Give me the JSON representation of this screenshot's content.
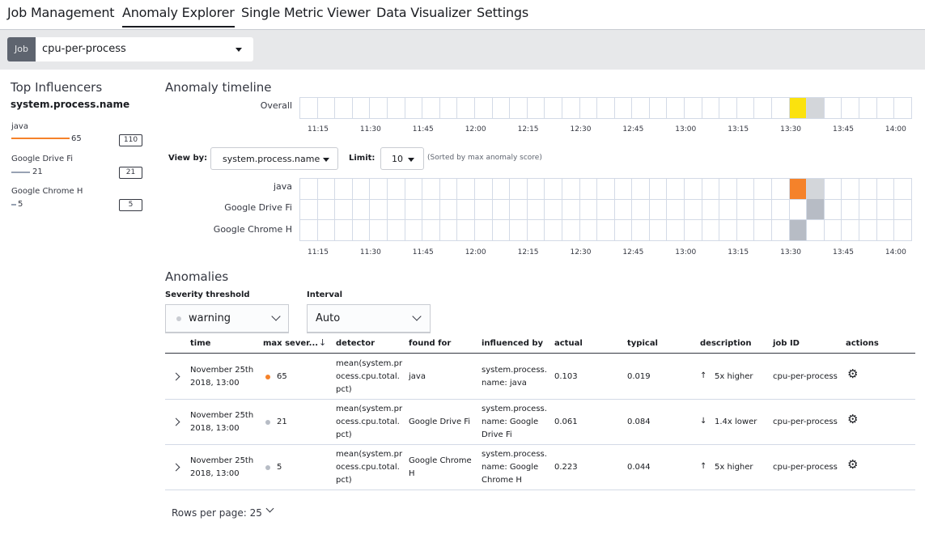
{
  "nav": {
    "tabs": [
      {
        "label": "Job Management",
        "active": false
      },
      {
        "label": "Anomaly Explorer",
        "active": true
      },
      {
        "label": "Single Metric Viewer",
        "active": false
      },
      {
        "label": "Data Visualizer",
        "active": false
      },
      {
        "label": "Settings",
        "active": false
      }
    ]
  },
  "job": {
    "tag": "Job",
    "selected": "cpu-per-process"
  },
  "influencers": {
    "title": "Top Influencers",
    "field": "system.process.name",
    "items": [
      {
        "label": "java",
        "score": "65",
        "count": "110",
        "score_fraction": 0.65,
        "color": "#f5822a"
      },
      {
        "label": "Google Drive Fi",
        "score": "21",
        "count": "21",
        "score_fraction": 0.21,
        "color": "#98a2b3"
      },
      {
        "label": "Google Chrome H",
        "score": "5",
        "count": "5",
        "score_fraction": 0.05,
        "color": "#98a2b3"
      }
    ]
  },
  "timeline": {
    "title": "Anomaly timeline",
    "overall_label": "Overall",
    "axis_ticks": [
      "11:15",
      "11:30",
      "11:45",
      "12:00",
      "12:15",
      "12:30",
      "12:45",
      "13:00",
      "13:15",
      "13:30",
      "13:45",
      "14:00"
    ],
    "view_by_label": "View by:",
    "view_by_value": "system.process.name",
    "limit_label": "Limit:",
    "limit_value": "10",
    "sort_note": "(Sorted by max anomaly score)",
    "overall_cells": [
      {
        "index": 28,
        "color": "#fbe20e"
      },
      {
        "index": 29,
        "color": "#d3d6da"
      }
    ],
    "swimlanes": [
      {
        "label": "java",
        "cells": [
          {
            "index": 28,
            "color": "#f5822a"
          },
          {
            "index": 29,
            "color": "#d3d6da"
          }
        ]
      },
      {
        "label": "Google Drive Fi",
        "cells": [
          {
            "index": 29,
            "color": "#b7bcc5"
          }
        ]
      },
      {
        "label": "Google Chrome H",
        "cells": [
          {
            "index": 28,
            "color": "#b7bcc5"
          }
        ]
      }
    ]
  },
  "anomalies": {
    "title": "Anomalies",
    "severity_label": "Severity threshold",
    "severity_value": "warning",
    "interval_label": "Interval",
    "interval_value": "Auto",
    "columns": {
      "time": "time",
      "max_severity": "max sever...",
      "detector": "detector",
      "found_for": "found for",
      "influenced_by": "influenced by",
      "actual": "actual",
      "typical": "typical",
      "description": "description",
      "job_id": "job ID",
      "actions": "actions"
    },
    "rows": [
      {
        "time_1": "November 25th",
        "time_2": "2018, 13:00",
        "severity": "65",
        "severity_color": "#f5822a",
        "detector_1": "mean(system.pr",
        "detector_2": "ocess.cpu.total.",
        "detector_3": "pct)",
        "found_for_1": "java",
        "found_for_2": "",
        "influenced_1": "system.process.",
        "influenced_2": "name: java",
        "influenced_3": "",
        "actual": "0.103",
        "typical": "0.019",
        "desc_icon": "↑",
        "description": "5x higher",
        "job_id": "cpu-per-process"
      },
      {
        "time_1": "November 25th",
        "time_2": "2018, 13:00",
        "severity": "21",
        "severity_color": "#b7bcc5",
        "detector_1": "mean(system.pr",
        "detector_2": "ocess.cpu.total.",
        "detector_3": "pct)",
        "found_for_1": "Google Drive Fi",
        "found_for_2": "",
        "influenced_1": "system.process.",
        "influenced_2": "name: Google",
        "influenced_3": "Drive Fi",
        "actual": "0.061",
        "typical": "0.084",
        "desc_icon": "↓",
        "description": "1.4x lower",
        "job_id": "cpu-per-process"
      },
      {
        "time_1": "November 25th",
        "time_2": "2018, 13:00",
        "severity": "5",
        "severity_color": "#b7bcc5",
        "detector_1": "mean(system.pr",
        "detector_2": "ocess.cpu.total.",
        "detector_3": "pct)",
        "found_for_1": "Google Chrome",
        "found_for_2": "H",
        "influenced_1": "system.process.",
        "influenced_2": "name: Google",
        "influenced_3": "Chrome H",
        "actual": "0.223",
        "typical": "0.044",
        "desc_icon": "↑",
        "description": "5x higher",
        "job_id": "cpu-per-process"
      }
    ],
    "rows_per_page_label": "Rows per page: 25"
  }
}
